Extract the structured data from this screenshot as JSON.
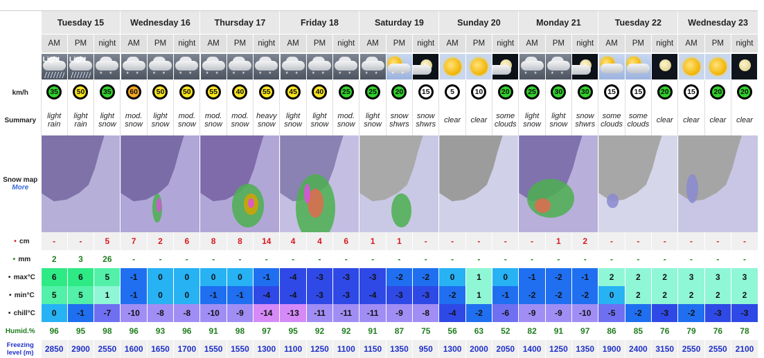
{
  "row_labels": {
    "wind": "km/h",
    "summary": "Summary",
    "snowmap": "Snow map",
    "more": "More",
    "snow": "cm",
    "rain": "mm",
    "max": "max°C",
    "min": "min°C",
    "chill": "chill°C",
    "humid": "Humid.%",
    "freezing": "Freezing level (m)"
  },
  "days": [
    "Tuesday 15",
    "Wednesday 16",
    "Thursday 17",
    "Friday 18",
    "Saturday 19",
    "Sunday 20",
    "Monday 21",
    "Tuesday 22",
    "Wednesday 23"
  ],
  "periods": [
    "AM",
    "PM",
    "night",
    "AM",
    "PM",
    "night",
    "AM",
    "PM",
    "night",
    "AM",
    "PM",
    "night",
    "AM",
    "PM",
    "night",
    "AM",
    "PM",
    "night",
    "AM",
    "PM",
    "night",
    "AM",
    "PM",
    "night",
    "AM",
    "PM",
    "night"
  ],
  "icons": [
    {
      "type": "cloudy",
      "rain": true,
      "text": "Light"
    },
    {
      "type": "cloudy",
      "rain": true,
      "text": "Light"
    },
    {
      "type": "cloudy",
      "snow": true
    },
    {
      "type": "cloudy",
      "snow": true
    },
    {
      "type": "cloudy",
      "snow": true
    },
    {
      "type": "cloudy",
      "snow": true
    },
    {
      "type": "cloudy",
      "snow": true
    },
    {
      "type": "cloudy",
      "snow": true
    },
    {
      "type": "cloudy",
      "snow": true
    },
    {
      "type": "cloudy",
      "snow": true
    },
    {
      "type": "cloudy",
      "snow": true
    },
    {
      "type": "cloudy",
      "snow": true
    },
    {
      "type": "cloudy",
      "snow": true
    },
    {
      "type": "part",
      "snow": true
    },
    {
      "type": "pnight"
    },
    {
      "type": "sun"
    },
    {
      "type": "sun"
    },
    {
      "type": "pnight"
    },
    {
      "type": "cloudy",
      "snow": true
    },
    {
      "type": "cloudy",
      "snow": true
    },
    {
      "type": "pnight"
    },
    {
      "type": "part"
    },
    {
      "type": "part"
    },
    {
      "type": "night"
    },
    {
      "type": "sun"
    },
    {
      "type": "sun"
    },
    {
      "type": "night"
    }
  ],
  "wind": [
    {
      "v": "35",
      "c": "g"
    },
    {
      "v": "50",
      "c": "y"
    },
    {
      "v": "35",
      "c": "g"
    },
    {
      "v": "60",
      "c": "o"
    },
    {
      "v": "50",
      "c": "y"
    },
    {
      "v": "50",
      "c": "y"
    },
    {
      "v": "55",
      "c": "y"
    },
    {
      "v": "40",
      "c": "y"
    },
    {
      "v": "55",
      "c": "y"
    },
    {
      "v": "45",
      "c": "y"
    },
    {
      "v": "40",
      "c": "y"
    },
    {
      "v": "25",
      "c": "g"
    },
    {
      "v": "25",
      "c": "g"
    },
    {
      "v": "20",
      "c": "g"
    },
    {
      "v": "15",
      "c": "w"
    },
    {
      "v": "5",
      "c": "w"
    },
    {
      "v": "10",
      "c": "w"
    },
    {
      "v": "20",
      "c": "g"
    },
    {
      "v": "25",
      "c": "g"
    },
    {
      "v": "30",
      "c": "g"
    },
    {
      "v": "30",
      "c": "g"
    },
    {
      "v": "15",
      "c": "w"
    },
    {
      "v": "15",
      "c": "w"
    },
    {
      "v": "20",
      "c": "g"
    },
    {
      "v": "15",
      "c": "w"
    },
    {
      "v": "20",
      "c": "g"
    },
    {
      "v": "20",
      "c": "g"
    }
  ],
  "summary": [
    [
      "light",
      "rain"
    ],
    [
      "light",
      "rain"
    ],
    [
      "light",
      "snow"
    ],
    [
      "mod.",
      "snow"
    ],
    [
      "light",
      "snow"
    ],
    [
      "mod.",
      "snow"
    ],
    [
      "mod.",
      "snow"
    ],
    [
      "mod.",
      "snow"
    ],
    [
      "heavy",
      "snow"
    ],
    [
      "light",
      "snow"
    ],
    [
      "light",
      "snow"
    ],
    [
      "mod.",
      "snow"
    ],
    [
      "light",
      "snow"
    ],
    [
      "snow",
      "shwrs"
    ],
    [
      "snow",
      "shwrs"
    ],
    [
      "clear",
      ""
    ],
    [
      "clear",
      ""
    ],
    [
      "some",
      "clouds"
    ],
    [
      "light",
      "snow"
    ],
    [
      "light",
      "snow"
    ],
    [
      "snow",
      "shwrs"
    ],
    [
      "some",
      "clouds"
    ],
    [
      "some",
      "clouds"
    ],
    [
      "clear",
      ""
    ],
    [
      "clear",
      ""
    ],
    [
      "clear",
      ""
    ],
    [
      "clear",
      ""
    ]
  ],
  "snow_cm": [
    "-",
    "-",
    "5",
    "7",
    "2",
    "6",
    "8",
    "8",
    "14",
    "4",
    "4",
    "6",
    "1",
    "1",
    "-",
    "-",
    "-",
    "-",
    "-",
    "1",
    "2",
    "-",
    "-",
    "-",
    "-",
    "-",
    "-"
  ],
  "rain_mm": [
    "2",
    "3",
    "26",
    "-",
    "-",
    "-",
    "-",
    "-",
    "-",
    "-",
    "-",
    "-",
    "-",
    "-",
    "-",
    "-",
    "-",
    "-",
    "-",
    "-",
    "-",
    "-",
    "-",
    "-",
    "-",
    "-",
    "-"
  ],
  "max_c": [
    "6",
    "6",
    "5",
    "-1",
    "0",
    "0",
    "0",
    "0",
    "-1",
    "-4",
    "-3",
    "-3",
    "-3",
    "-2",
    "-2",
    "0",
    "1",
    "0",
    "-1",
    "-2",
    "-1",
    "2",
    "2",
    "2",
    "3",
    "3",
    "3"
  ],
  "min_c": [
    "5",
    "5",
    "1",
    "-1",
    "0",
    "0",
    "-1",
    "-1",
    "-4",
    "-4",
    "-3",
    "-3",
    "-4",
    "-3",
    "-3",
    "-2",
    "1",
    "-1",
    "-2",
    "-2",
    "-2",
    "0",
    "2",
    "2",
    "2",
    "2",
    "2"
  ],
  "chill_c": [
    "0",
    "-1",
    "-7",
    "-10",
    "-8",
    "-8",
    "-10",
    "-9",
    "-14",
    "-13",
    "-11",
    "-11",
    "-11",
    "-9",
    "-8",
    "-4",
    "-2",
    "-6",
    "-9",
    "-9",
    "-10",
    "-5",
    "-2",
    "-3",
    "-2",
    "-3",
    "-3"
  ],
  "humid": [
    "96",
    "95",
    "98",
    "96",
    "93",
    "96",
    "91",
    "98",
    "97",
    "95",
    "92",
    "92",
    "91",
    "87",
    "75",
    "56",
    "63",
    "52",
    "82",
    "91",
    "97",
    "86",
    "85",
    "76",
    "79",
    "76",
    "78"
  ],
  "freezing": [
    "2850",
    "2900",
    "2550",
    "1600",
    "1650",
    "1700",
    "1550",
    "1550",
    "1300",
    "1100",
    "1250",
    "1100",
    "1150",
    "1350",
    "950",
    "1300",
    "2000",
    "2050",
    "1400",
    "1250",
    "1350",
    "1900",
    "2400",
    "3150",
    "2550",
    "2550",
    "2100"
  ],
  "colors": {
    "temp_hot2": "#2eea85",
    "temp_hot1": "#52f0a8",
    "temp_warm": "#8ff6d6",
    "temp_zero": "#27b2f4",
    "temp_cold1": "#1f6ff0",
    "temp_cold2": "#2f49e6",
    "temp_cold3": "#6f6ff2",
    "temp_cold4": "#a08ef5",
    "temp_cold5": "#d58af8"
  }
}
